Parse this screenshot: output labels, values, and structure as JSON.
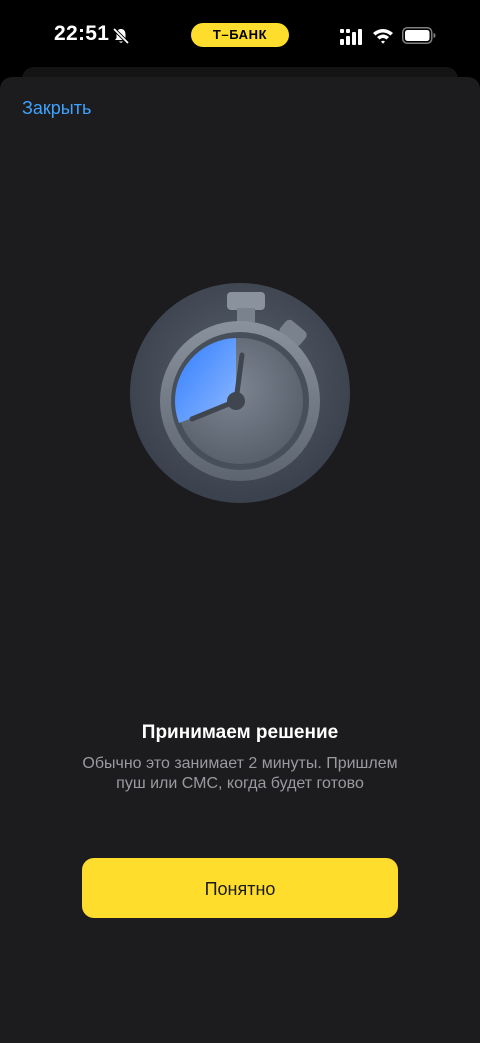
{
  "status_bar": {
    "time": "22:51",
    "carrier": "Т–БАНК",
    "icons": [
      "bell-off-icon",
      "signal-icon",
      "wifi-icon",
      "battery-icon"
    ]
  },
  "header": {
    "close_label": "Закрыть"
  },
  "illustration": {
    "icon": "stopwatch-icon"
  },
  "content": {
    "title": "Принимаем решение",
    "subtitle": "Обычно это занимает 2 минуты. Пришлем пуш или СМС, когда будет готово"
  },
  "actions": {
    "primary_label": "Понятно"
  },
  "colors": {
    "accent_yellow": "#ffdd2d",
    "link_blue": "#3ea2ff",
    "sheet_background": "#1c1c1e"
  }
}
